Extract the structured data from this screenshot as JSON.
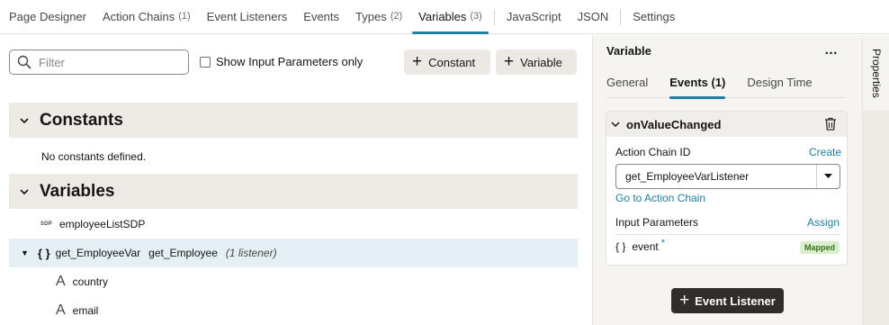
{
  "tabs": [
    {
      "label": "Page Designer",
      "count": ""
    },
    {
      "label": "Action Chains",
      "count": "(1)"
    },
    {
      "label": "Event Listeners",
      "count": ""
    },
    {
      "label": "Events",
      "count": ""
    },
    {
      "label": "Types",
      "count": "(2)"
    },
    {
      "label": "Variables",
      "count": "(3)"
    },
    {
      "label": "JavaScript",
      "count": ""
    },
    {
      "label": "JSON",
      "count": ""
    },
    {
      "label": "Settings",
      "count": ""
    }
  ],
  "toolbar": {
    "filter_placeholder": "Filter",
    "show_input_label": "Show Input Parameters only",
    "constant_label": "Constant",
    "variable_label": "Variable"
  },
  "constants": {
    "title": "Constants",
    "empty_text": "No constants defined."
  },
  "variables": {
    "title": "Variables",
    "items": [
      {
        "icon": "SDP",
        "name": "employeeListSDP",
        "type": "",
        "listeners": ""
      },
      {
        "icon": "{ }",
        "name": "get_EmployeeVar",
        "type": "get_Employee",
        "listeners": "(1 listener)"
      }
    ],
    "fields": [
      {
        "icon": "A",
        "name": "country"
      },
      {
        "icon": "A",
        "name": "email"
      }
    ]
  },
  "properties": {
    "title": "Variable",
    "more": "…",
    "tabs": [
      "General",
      "Events (1)",
      "Design Time"
    ],
    "event": {
      "name": "onValueChanged",
      "action_chain_label": "Action Chain ID",
      "create_label": "Create",
      "action_chain_value": "get_EmployeeVarListener",
      "goto_label": "Go to Action Chain",
      "input_params_label": "Input Parameters",
      "assign_label": "Assign",
      "param_icon": "{ }",
      "param_name": "event",
      "param_required": "*",
      "param_status": "Mapped"
    },
    "event_listener_button": "Event Listener"
  },
  "rail": {
    "label": "Properties"
  },
  "colors": {
    "accent": "#227e9e",
    "mapped_badge": "#d9eecc",
    "selected_row": "#e4f0f6",
    "dark_button": "#312d2a"
  }
}
